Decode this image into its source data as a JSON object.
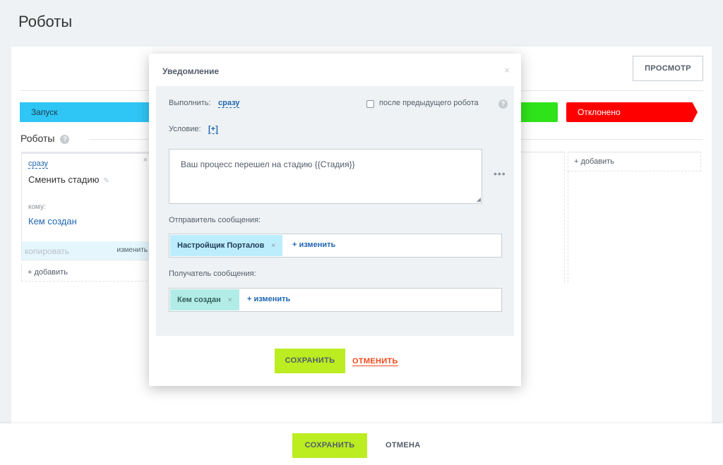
{
  "page": {
    "title": "Роботы"
  },
  "toolbar": {
    "preview_label": "ПРОСМОТР"
  },
  "stages": {
    "start": "Запуск",
    "rejected": "Отклонено"
  },
  "robots_section": {
    "label": "Роботы",
    "help": "?"
  },
  "robot_card": {
    "when": "сразу",
    "name": "Сменить стадию",
    "to_label": "кому:",
    "to_value": "Кем создан",
    "copy_label": "копировать",
    "edit_label": "изменить"
  },
  "add_label": "+ добавить",
  "bottom": {
    "save_label": "СОХРАНИТЬ",
    "cancel_label": "ОТМЕНА"
  },
  "dialog": {
    "title": "Уведомление",
    "execute_label": "Выполнить:",
    "execute_value": "сразу",
    "after_prev_label": "после предыдущего робота",
    "condition_label": "Условие:",
    "condition_value": "[+]",
    "message_text": "Ваш процесс перешел на стадию {{Стадия}}",
    "sender_label": "Отправитель сообщения:",
    "sender_chip": "Настройщик Порталов",
    "recipient_label": "Получатель сообщения:",
    "recipient_chip": "Кем создан",
    "change_label": "+ изменить",
    "save_label": "СОХРАНИТЬ",
    "cancel_label": "ОТМЕНИТЬ"
  }
}
